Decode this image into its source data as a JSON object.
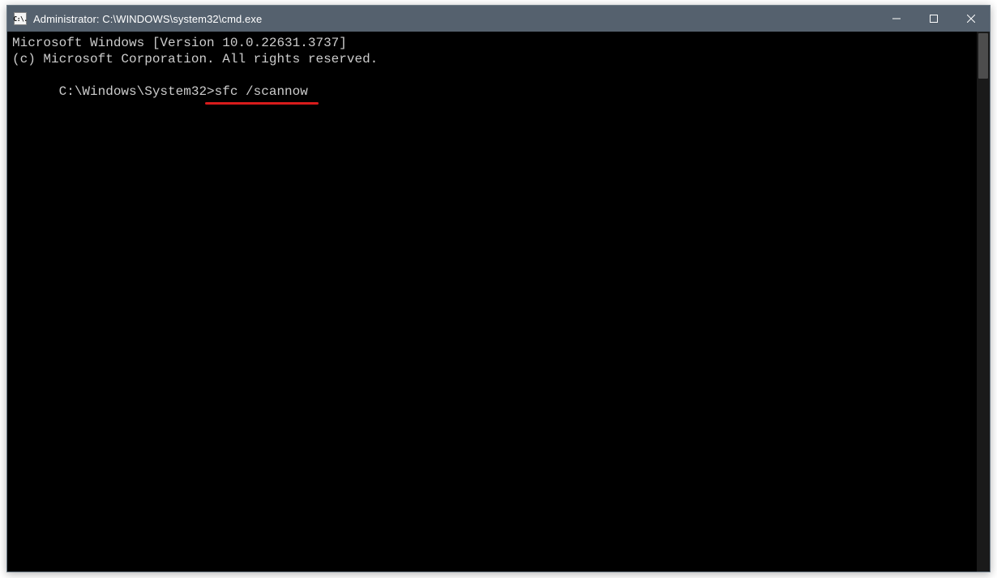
{
  "titlebar": {
    "icon_label": "C:\\.",
    "title": "Administrator: C:\\WINDOWS\\system32\\cmd.exe"
  },
  "terminal": {
    "line1": "Microsoft Windows [Version 10.0.22631.3737]",
    "line2": "(c) Microsoft Corporation. All rights reserved.",
    "blank": "",
    "prompt": "C:\\Windows\\System32>",
    "command": "sfc /scannow"
  },
  "annotation": {
    "underline_color": "#d81c1c"
  }
}
